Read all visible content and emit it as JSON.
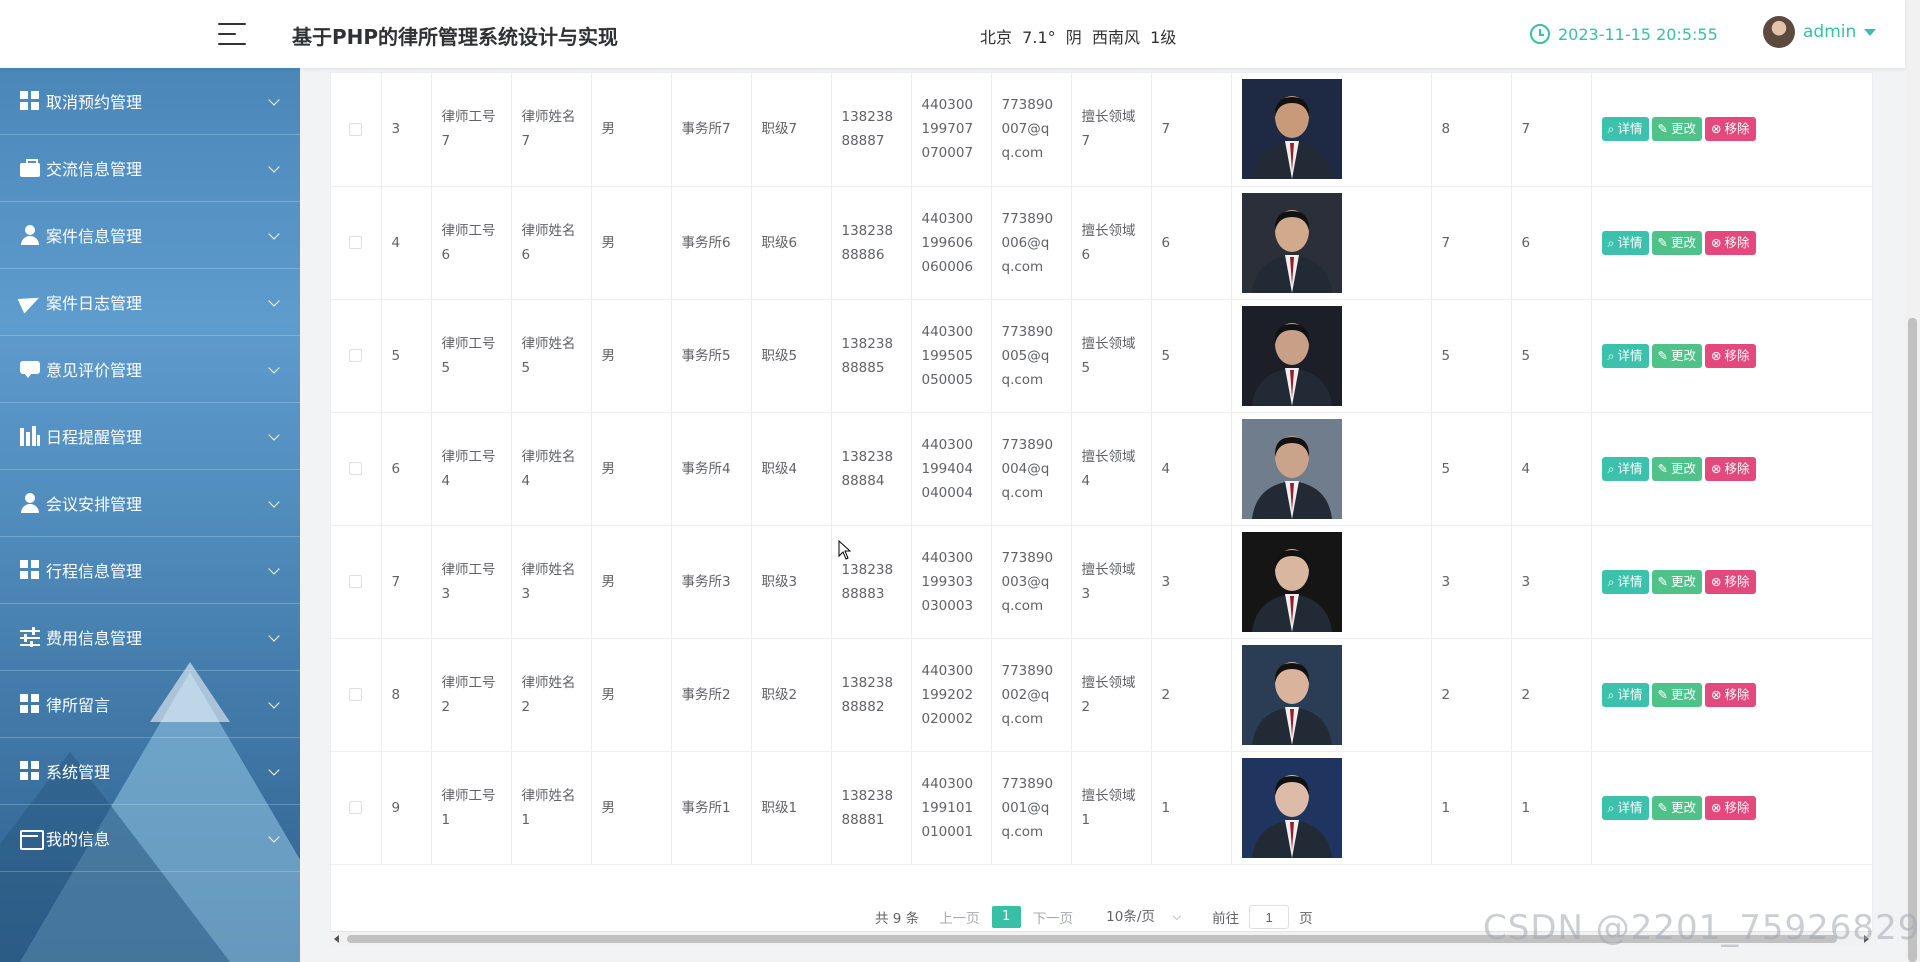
{
  "header": {
    "title": "基于PHP的律所管理系统设计与实现",
    "weather": "北京  7.1°  阴  西南风  1级",
    "datetime": "2023-11-15 20:5:55",
    "username": "admin"
  },
  "sidebar": {
    "items": [
      {
        "label": "取消预约管理",
        "icon": "grid-icon"
      },
      {
        "label": "交流信息管理",
        "icon": "briefcase-icon"
      },
      {
        "label": "案件信息管理",
        "icon": "user-icon"
      },
      {
        "label": "案件日志管理",
        "icon": "paper-plane-icon"
      },
      {
        "label": "意见评价管理",
        "icon": "comment-icon"
      },
      {
        "label": "日程提醒管理",
        "icon": "bar-chart-icon"
      },
      {
        "label": "会议安排管理",
        "icon": "user-icon"
      },
      {
        "label": "行程信息管理",
        "icon": "grid-icon"
      },
      {
        "label": "费用信息管理",
        "icon": "sliders-icon"
      },
      {
        "label": "律所留言",
        "icon": "grid-icon"
      },
      {
        "label": "系统管理",
        "icon": "grid-icon"
      },
      {
        "label": "我的信息",
        "icon": "id-card-icon"
      }
    ]
  },
  "table": {
    "rows": [
      {
        "index": "3",
        "job_no": "律师工号7",
        "name": "律师姓名7",
        "gender": "男",
        "firm": "事务所7",
        "rank": "职级7",
        "phone": "13823888887",
        "id_card": "440300199707070007",
        "email": "773890007@qq.com",
        "field": "擅长领域7",
        "col_a": "7",
        "col_b": "8",
        "col_c": "7"
      },
      {
        "index": "4",
        "job_no": "律师工号6",
        "name": "律师姓名6",
        "gender": "男",
        "firm": "事务所6",
        "rank": "职级6",
        "phone": "13823888886",
        "id_card": "440300199606060006",
        "email": "773890006@qq.com",
        "field": "擅长领域6",
        "col_a": "6",
        "col_b": "7",
        "col_c": "6"
      },
      {
        "index": "5",
        "job_no": "律师工号5",
        "name": "律师姓名5",
        "gender": "男",
        "firm": "事务所5",
        "rank": "职级5",
        "phone": "13823888885",
        "id_card": "440300199505050005",
        "email": "773890005@qq.com",
        "field": "擅长领域5",
        "col_a": "5",
        "col_b": "5",
        "col_c": "5"
      },
      {
        "index": "6",
        "job_no": "律师工号4",
        "name": "律师姓名4",
        "gender": "男",
        "firm": "事务所4",
        "rank": "职级4",
        "phone": "13823888884",
        "id_card": "440300199404040004",
        "email": "773890004@qq.com",
        "field": "擅长领域4",
        "col_a": "4",
        "col_b": "5",
        "col_c": "4"
      },
      {
        "index": "7",
        "job_no": "律师工号3",
        "name": "律师姓名3",
        "gender": "男",
        "firm": "事务所3",
        "rank": "职级3",
        "phone": "13823888883",
        "id_card": "440300199303030003",
        "email": "773890003@qq.com",
        "field": "擅长领域3",
        "col_a": "3",
        "col_b": "3",
        "col_c": "3"
      },
      {
        "index": "8",
        "job_no": "律师工号2",
        "name": "律师姓名2",
        "gender": "男",
        "firm": "事务所2",
        "rank": "职级2",
        "phone": "13823888882",
        "id_card": "440300199202020002",
        "email": "773890002@qq.com",
        "field": "擅长领域2",
        "col_a": "2",
        "col_b": "2",
        "col_c": "2"
      },
      {
        "index": "9",
        "job_no": "律师工号1",
        "name": "律师姓名1",
        "gender": "男",
        "firm": "事务所1",
        "rank": "职级1",
        "phone": "13823888881",
        "id_card": "440300199101010001",
        "email": "773890001@qq.com",
        "field": "擅长领域1",
        "col_a": "1",
        "col_b": "1",
        "col_c": "1"
      }
    ],
    "actions": {
      "detail": "详情",
      "edit": "更改",
      "delete": "移除"
    }
  },
  "pagination": {
    "total": "共 9 条",
    "prev": "上一页",
    "current": "1",
    "next": "下一页",
    "page_size": "10条/页",
    "goto_prefix": "前往",
    "goto_value": "1",
    "goto_suffix": "页"
  },
  "watermark": "CSDN @2201_75926829",
  "colors": {
    "accent": "#37c0a5",
    "detail_button": "#3cc2ac",
    "edit_button": "#4fc28a",
    "delete_button": "#e3497c"
  }
}
